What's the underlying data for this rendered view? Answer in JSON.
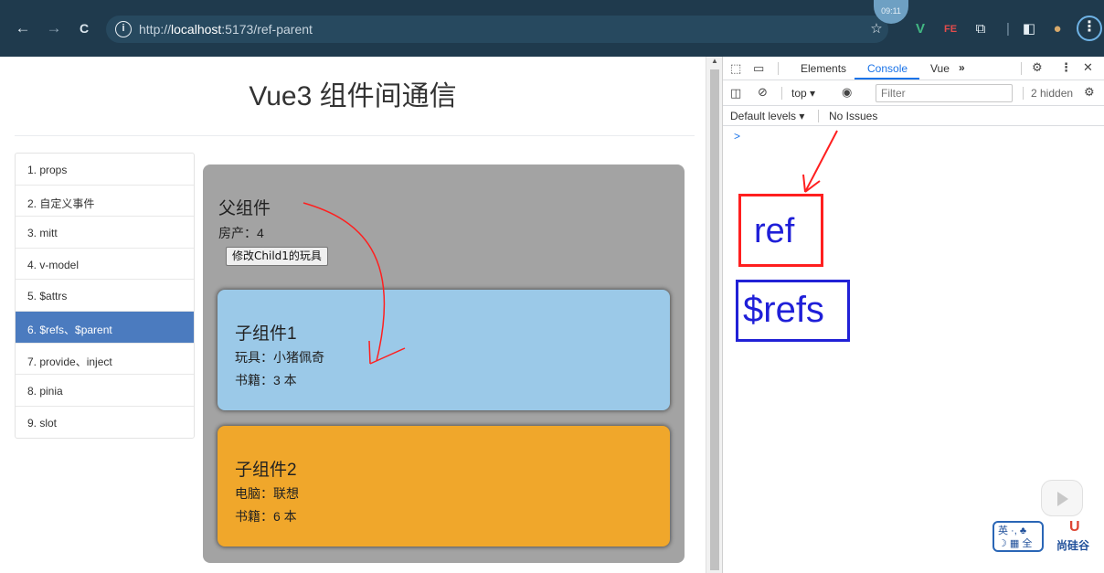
{
  "browser": {
    "back": "←",
    "forward": "→",
    "reload": "C",
    "url_prefix": "http://",
    "url_host": "localhost",
    "url_rest": ":5173/ref-parent",
    "clock": "09:11"
  },
  "page": {
    "title": "Vue3 组件间通信",
    "sidebar": [
      {
        "label": "1. props"
      },
      {
        "label": "2. 自定义事件"
      },
      {
        "label": "3. mitt"
      },
      {
        "label": "4. v-model"
      },
      {
        "label": "5. $attrs"
      },
      {
        "label": "6. $refs、$parent"
      },
      {
        "label": "7. provide、inject"
      },
      {
        "label": "8. pinia"
      },
      {
        "label": "9. slot"
      }
    ],
    "parent": {
      "title": "父组件",
      "house": "房产：4",
      "button": "修改Child1的玩具"
    },
    "child1": {
      "title": "子组件1",
      "toy": "玩具：小猪佩奇",
      "books": "书籍：3 本"
    },
    "child2": {
      "title": "子组件2",
      "computer": "电脑：联想",
      "books": "书籍：6 本"
    }
  },
  "devtools": {
    "tabs": [
      "Elements",
      "Console",
      "Vue"
    ],
    "active_tab": "Console",
    "context": "top",
    "filter_placeholder": "Filter",
    "hidden": "2 hidden",
    "levels": "Default levels",
    "issues": "No Issues",
    "prompt": ">"
  },
  "annotations": {
    "ref": "ref",
    "refs": "$refs"
  },
  "ime": {
    "line1": "英 ·, ♣",
    "line2": "☽ ▦ 全",
    "brand": "尚硅谷"
  },
  "colors": {
    "active_item": "#4b7bbf",
    "child1_bg": "#9bc9e8",
    "child2_bg": "#f0a72b",
    "parent_bg": "#a3a3a3",
    "annotation_red": "#ff1f1f",
    "annotation_blue": "#2121d6"
  }
}
